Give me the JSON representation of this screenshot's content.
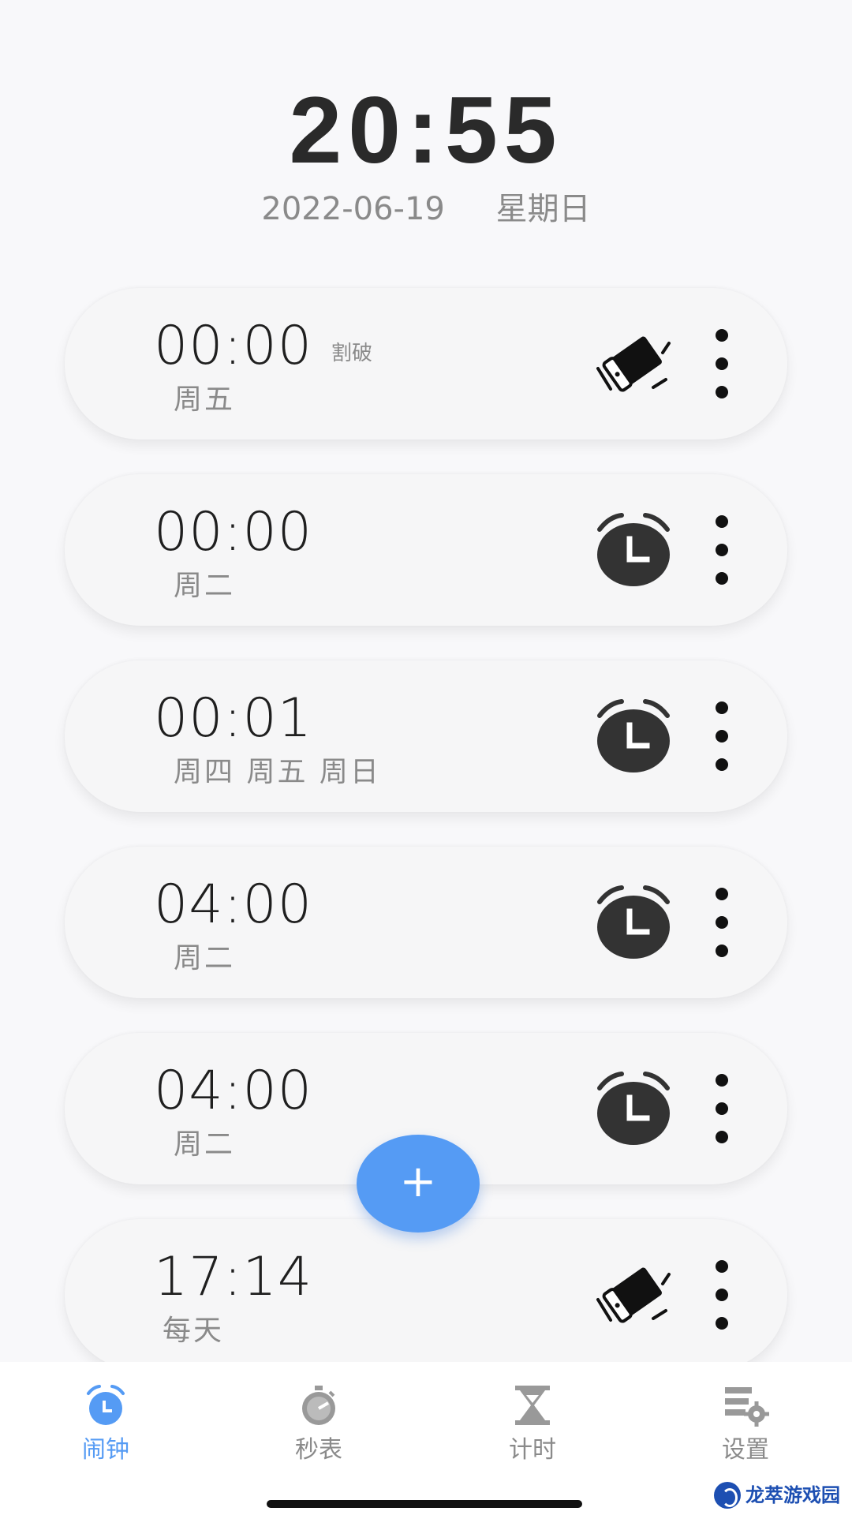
{
  "header": {
    "clock": "20:55",
    "date": "2022-06-19",
    "weekday": "星期日"
  },
  "alarms": [
    {
      "time": "00:00",
      "tag": "割破",
      "days": "周五",
      "kind": "shake-phone-icon"
    },
    {
      "time": "00:00",
      "tag": "",
      "days": "周二",
      "kind": "alarm-clock-icon"
    },
    {
      "time": "00:01",
      "tag": "",
      "days": "周四 周五 周日",
      "kind": "alarm-clock-icon"
    },
    {
      "time": "04:00",
      "tag": "",
      "days": "周二",
      "kind": "alarm-clock-icon"
    },
    {
      "time": "04:00",
      "tag": "",
      "days": "周二",
      "kind": "alarm-clock-icon"
    },
    {
      "time": "17:14",
      "tag": "",
      "days": "每天",
      "kind": "shake-phone-icon"
    }
  ],
  "fab": {
    "label": "+"
  },
  "nav": [
    {
      "label": "闹钟",
      "icon": "alarm-clock-icon",
      "active": true
    },
    {
      "label": "秒表",
      "icon": "stopwatch-icon",
      "active": false
    },
    {
      "label": "计时",
      "icon": "hourglass-icon",
      "active": false
    },
    {
      "label": "设置",
      "icon": "settings-icon",
      "active": false
    }
  ],
  "watermark": {
    "text": "龙萃游戏园"
  },
  "colors": {
    "accent": "#559bf4",
    "background": "#f8f8fa",
    "text": "#1f1f1f",
    "muted": "#8a8a8a"
  }
}
